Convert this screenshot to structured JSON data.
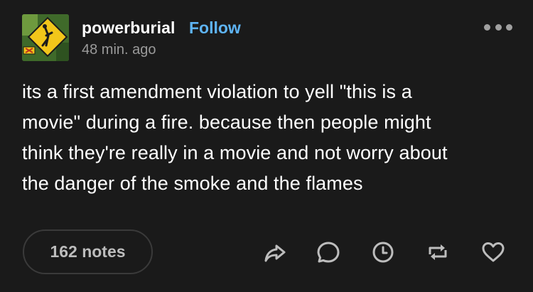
{
  "post": {
    "blog_name": "powerburial",
    "follow_label": "Follow",
    "timestamp": "48 min. ago",
    "body_lines": [
      "its a first amendment violation to yell \"this is a",
      "movie\" during a fire. because then people might",
      "think they're really in a movie and not worry about",
      "the danger of the smoke and the flames"
    ],
    "notes_label": "162 notes"
  },
  "actions": [
    {
      "icon": "share-icon"
    },
    {
      "icon": "reply-icon"
    },
    {
      "icon": "queue-clock-icon"
    },
    {
      "icon": "reblog-icon"
    },
    {
      "icon": "heart-icon"
    }
  ],
  "colors": {
    "background": "#1a1a1a",
    "text": "#ffffff",
    "accent": "#5eb4f5",
    "muted": "#9a9a9a",
    "icon": "#bdbdbd"
  }
}
